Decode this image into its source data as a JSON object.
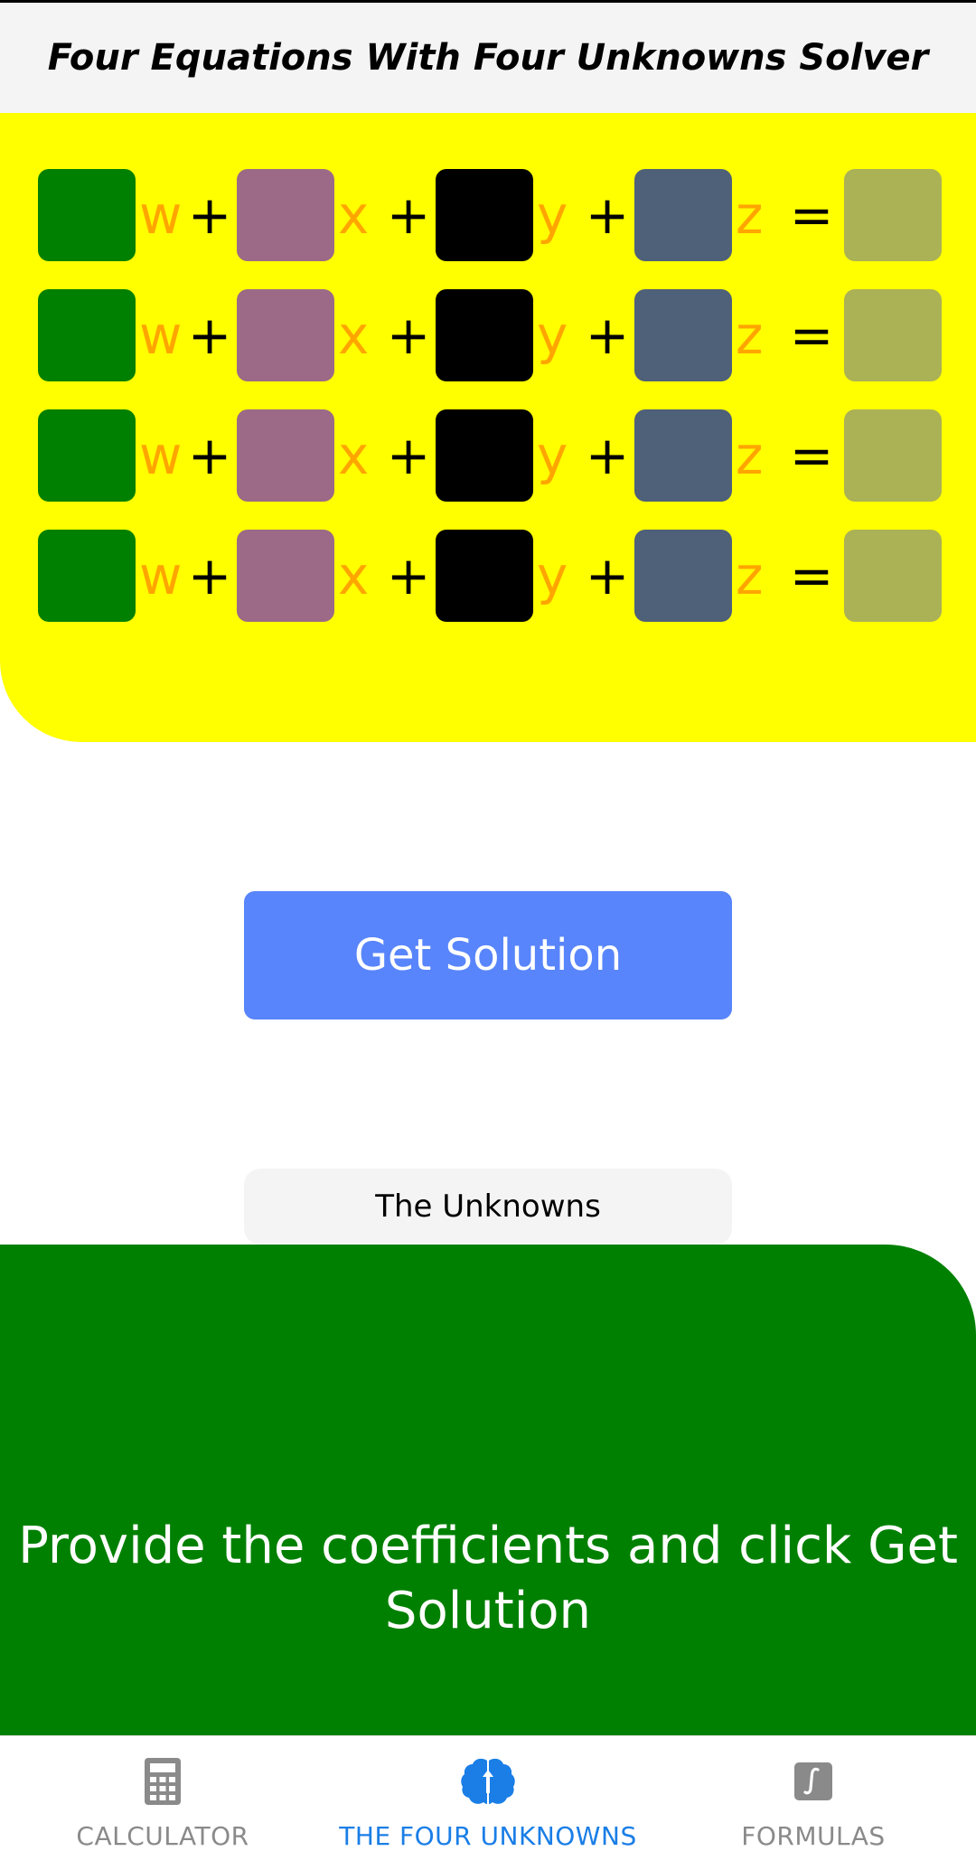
{
  "header": {
    "title": "Four Equations With Four Unknowns Solver"
  },
  "equations": {
    "rows": [
      {
        "w": "",
        "x": "",
        "y": "",
        "z": "",
        "result": ""
      },
      {
        "w": "",
        "x": "",
        "y": "",
        "z": "",
        "result": ""
      },
      {
        "w": "",
        "x": "",
        "y": "",
        "z": "",
        "result": ""
      },
      {
        "w": "",
        "x": "",
        "y": "",
        "z": "",
        "result": ""
      }
    ],
    "var_w": "w",
    "var_x": "x",
    "var_y": "y",
    "var_z": "z",
    "plus": "+",
    "equals": "="
  },
  "solve_button": {
    "label": "Get Solution"
  },
  "unknowns": {
    "label": "The Unknowns"
  },
  "result": {
    "message": "Provide the coefficients and click Get Solution"
  },
  "bottom_nav": {
    "items": [
      {
        "label": "CALCULATOR",
        "icon": "calculator-icon",
        "active": false
      },
      {
        "label": "THE FOUR UNKNOWNS",
        "icon": "brain-icon",
        "active": true
      },
      {
        "label": "FORMULAS",
        "icon": "integral-icon",
        "active": false
      }
    ]
  },
  "colors": {
    "panel_yellow": "#ffff00",
    "w_box": "#008000",
    "x_box": "#9c6a86",
    "y_box": "#000000",
    "z_box": "#4f6079",
    "result_box": "#abb155",
    "variable_text": "#ffa500",
    "button_blue": "#5885fb",
    "result_green": "#008000",
    "nav_active": "#1a7ee6"
  }
}
